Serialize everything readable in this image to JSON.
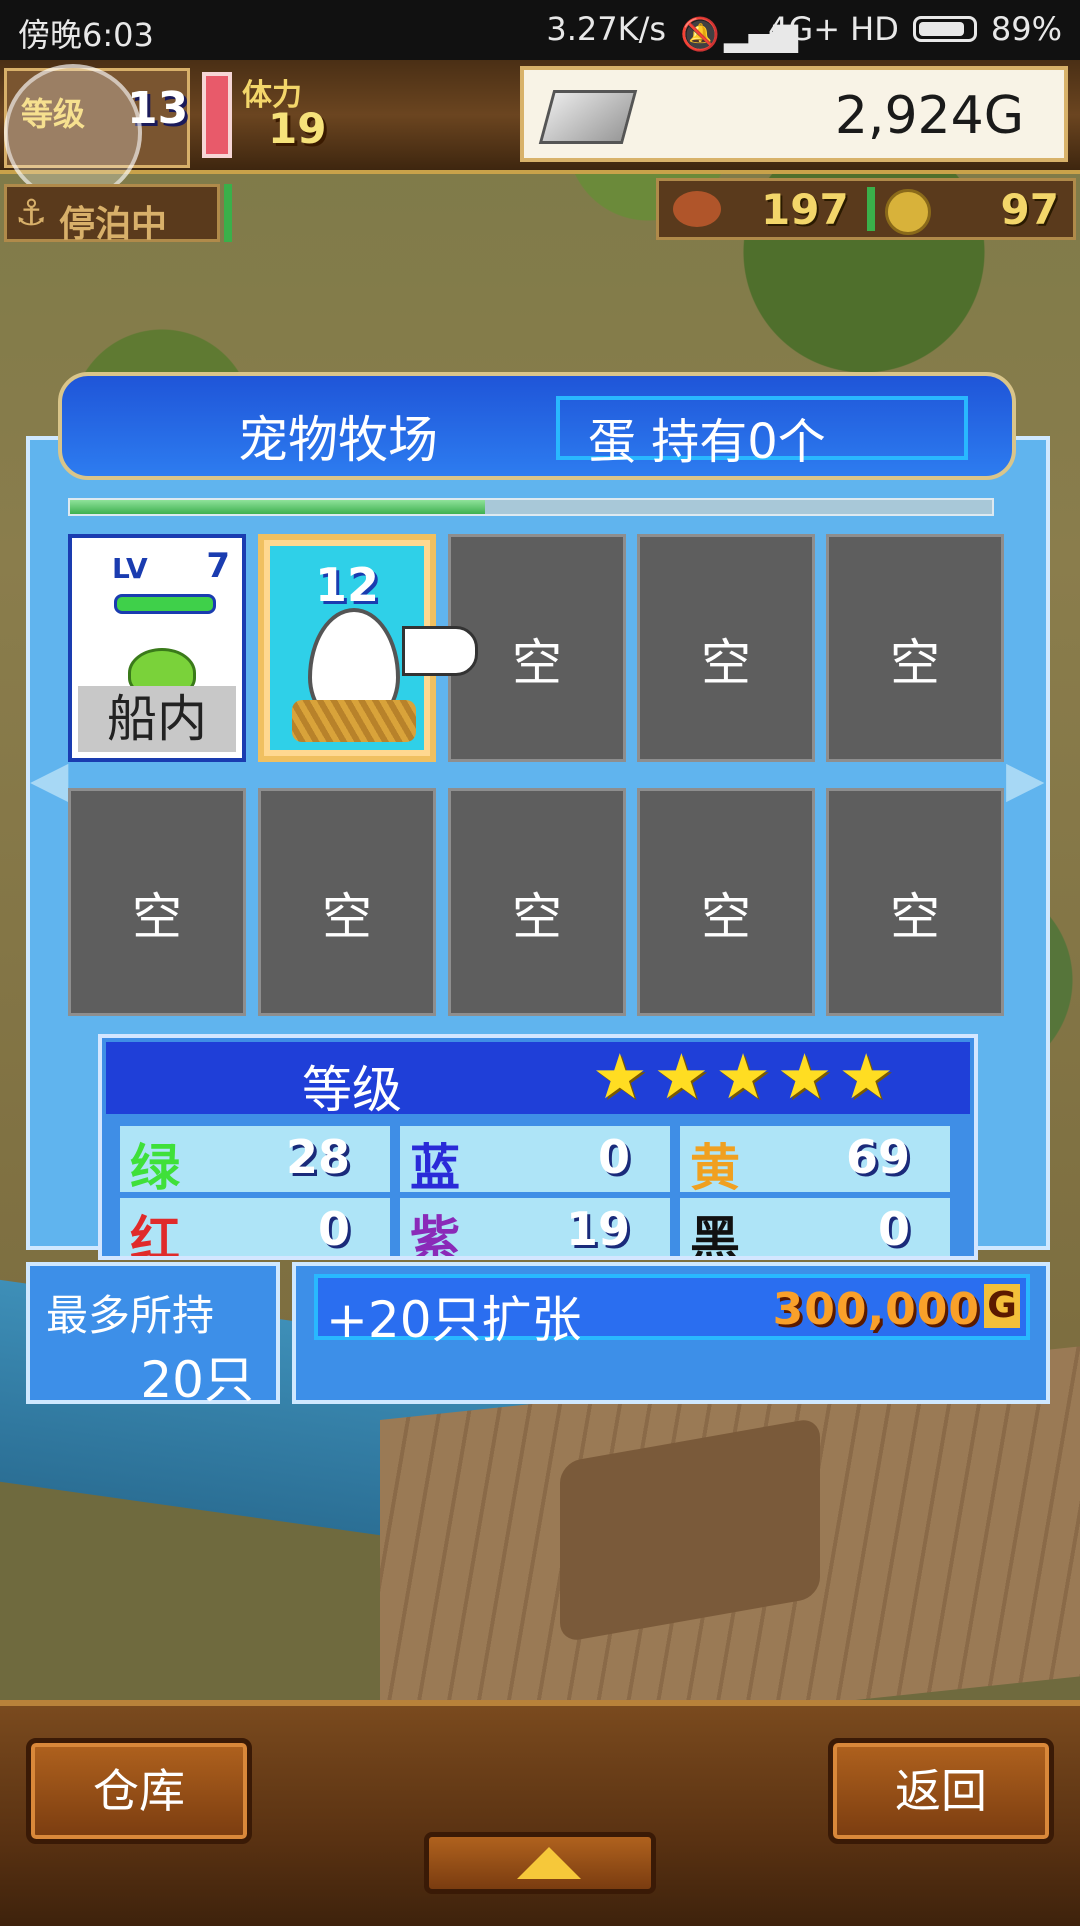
{
  "status_bar": {
    "time": "傍晚6:03",
    "network_speed": "3.27K/s",
    "network": "4G+ HD",
    "battery": "89%"
  },
  "hud": {
    "level_label": "等级",
    "level": "13",
    "stamina_label": "体力",
    "stamina": "19",
    "gold": "2,924G",
    "docked_label": "停泊中",
    "food": "197",
    "coins": "97"
  },
  "ranch": {
    "title": "宠物牧场",
    "egg_status": "蛋 持有0个",
    "progress": 0.45,
    "pet": {
      "level_label": "LV",
      "level": "7",
      "location": "船内"
    },
    "egg_slot": {
      "count": "12"
    },
    "empty_label": "空"
  },
  "stats": {
    "title": "等级",
    "stars": 5,
    "rows": [
      {
        "k": "绿",
        "v": "28",
        "color": "#3fe03a"
      },
      {
        "k": "蓝",
        "v": "0",
        "color": "#2a2ad8"
      },
      {
        "k": "黄",
        "v": "69",
        "color": "#f0a020"
      },
      {
        "k": "红",
        "v": "0",
        "color": "#e02a2a"
      },
      {
        "k": "紫",
        "v": "19",
        "color": "#8a2ab8"
      },
      {
        "k": "黑",
        "v": "0",
        "color": "#111111"
      }
    ]
  },
  "capacity": {
    "label": "最多所持",
    "value": "20只"
  },
  "expand": {
    "label": "+20只扩张",
    "price": "300,000",
    "currency": "G"
  },
  "bottom": {
    "warehouse": "仓库",
    "back": "返回"
  }
}
